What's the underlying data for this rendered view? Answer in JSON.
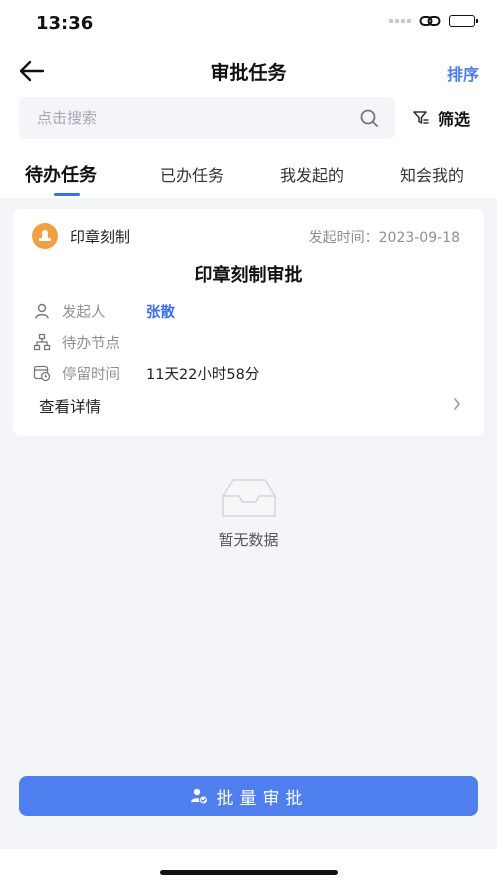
{
  "status_bar": {
    "time": "13:36"
  },
  "navbar": {
    "title": "审批任务",
    "sort_label": "排序"
  },
  "search": {
    "placeholder": "点击搜索",
    "value": ""
  },
  "filter": {
    "label": "筛选"
  },
  "tabs": [
    {
      "label": "待办任务",
      "active": true
    },
    {
      "label": "已办任务",
      "active": false
    },
    {
      "label": "我发起的",
      "active": false
    },
    {
      "label": "知会我的",
      "active": false
    }
  ],
  "task_card": {
    "type": "印章刻制",
    "time": "发起时间：2023-09-18",
    "title": "印章刻制审批",
    "rows": [
      {
        "icon": "user-icon",
        "label": "发起人",
        "value": "张散"
      },
      {
        "icon": "org-node-icon",
        "label": "待办节点",
        "value": ""
      },
      {
        "icon": "clock-calendar-icon",
        "label": "停留时间",
        "value": "11天22小时58分"
      }
    ],
    "detail_label": "查看详情"
  },
  "empty_state": {
    "text": "暂无数据"
  },
  "batch_button": {
    "label": "批量审批"
  },
  "colors": {
    "accent": "#4f7fef",
    "link": "#3b6fe8",
    "stamp": "#f0a043",
    "background": "#f4f5f9"
  }
}
